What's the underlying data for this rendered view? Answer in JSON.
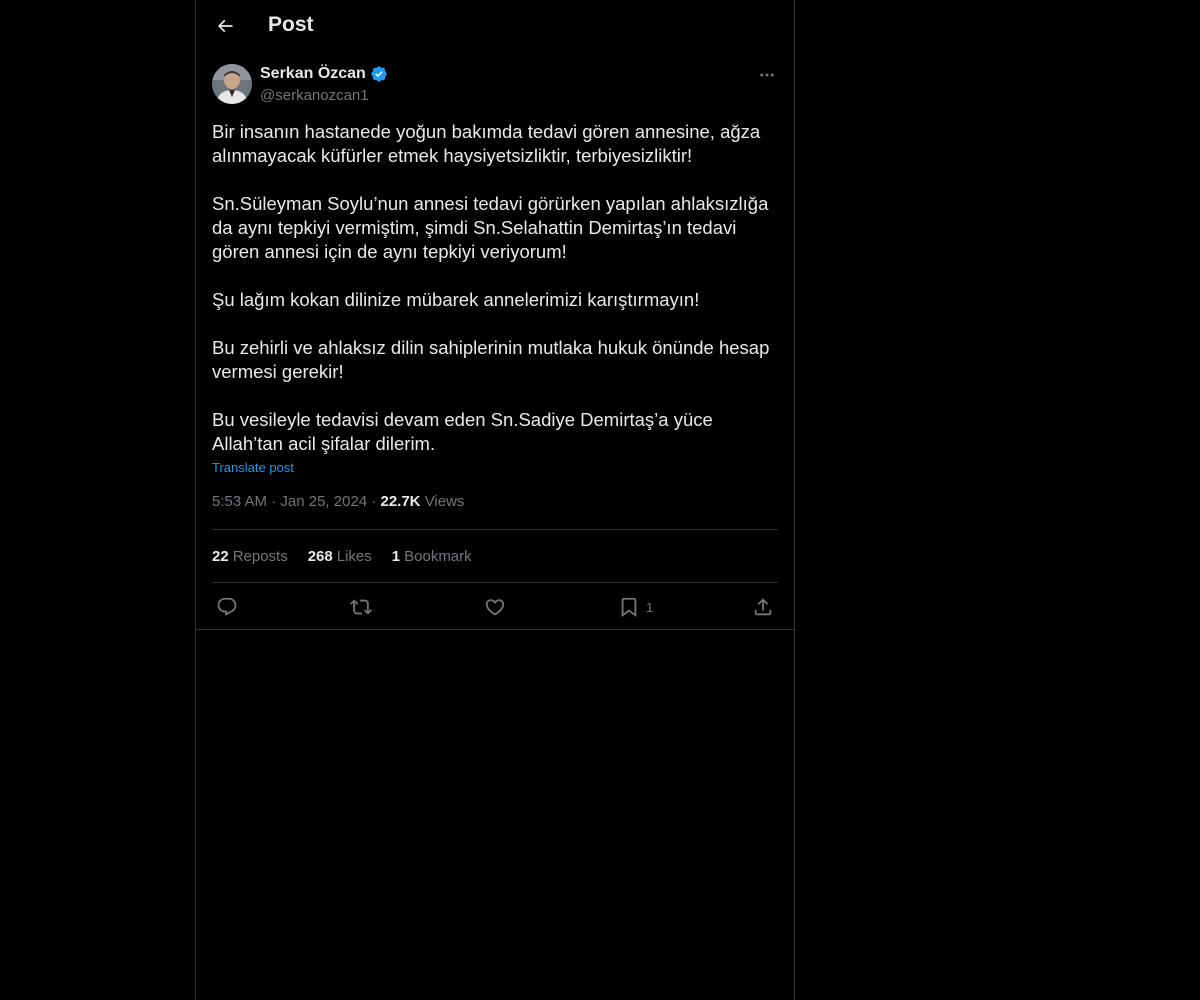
{
  "header": {
    "title": "Post"
  },
  "post": {
    "author": {
      "display_name": "Serkan Özcan",
      "handle": "@serkanozcan1",
      "verified": true
    },
    "text": "Bir insanın hastanede yoğun bakımda tedavi gören annesine, ağza alınmayacak küfürler etmek haysiyetsizliktir, terbiyesizliktir!\n\nSn.Süleyman Soylu’nun annesi tedavi görürken yapılan ahlaksızlığa da aynı tepkiyi vermiştim, şimdi Sn.Selahattin Demirtaş’ın tedavi gören annesi için de aynı tepkiyi veriyorum!\n\nŞu lağım kokan dilinize mübarek annelerimizi karıştırmayın!\n\nBu zehirli ve ahlaksız dilin sahiplerinin mutlaka hukuk önünde hesap vermesi gerekir!\n\nBu vesileyle tedavisi devam eden Sn.Sadiye Demirtaş’a yüce Allah’tan acil şifalar dilerim.",
    "translate_label": "Translate post",
    "time": "5:53 AM",
    "separator": "·",
    "date": "Jan 25, 2024",
    "views_count": "22.7K",
    "views_label": "Views",
    "stats": {
      "reposts_count": "22",
      "reposts_label": "Reposts",
      "likes_count": "268",
      "likes_label": "Likes",
      "bookmarks_count": "1",
      "bookmarks_label": "Bookmark"
    },
    "actions": {
      "bookmark_count": "1"
    }
  },
  "colors": {
    "background": "#000000",
    "text": "#e7e9ea",
    "secondary_text": "#71767b",
    "accent": "#1d9bf0",
    "border": "#2f3336"
  },
  "icons": {
    "back": "arrow-left-icon",
    "verified": "verified-badge-icon",
    "more": "more-horizontal-icon",
    "reply": "reply-bubble-icon",
    "repost": "repost-icon",
    "like": "heart-icon",
    "bookmark": "bookmark-icon",
    "share": "share-icon"
  }
}
